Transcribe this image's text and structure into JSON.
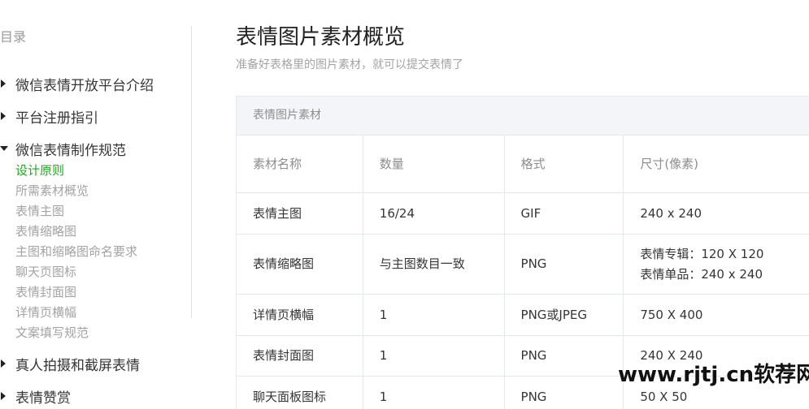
{
  "sidebar": {
    "title": "目录",
    "sections": [
      {
        "label": "微信表情开放平台介绍"
      },
      {
        "label": "平台注册指引"
      },
      {
        "label": "微信表情制作规范"
      },
      {
        "label": "真人拍摄和截屏表情"
      },
      {
        "label": "表情赞赏"
      }
    ],
    "sub_items": [
      {
        "label": "设计原则"
      },
      {
        "label": "所需素材概览"
      },
      {
        "label": "表情主图"
      },
      {
        "label": "表情缩略图"
      },
      {
        "label": "主图和缩略图命名要求"
      },
      {
        "label": "聊天页图标"
      },
      {
        "label": "表情封面图"
      },
      {
        "label": "详情页横幅"
      },
      {
        "label": "文案填写规范"
      }
    ]
  },
  "main": {
    "title": "表情图片素材概览",
    "subtitle": "准备好表格里的图片素材，就可以提交表情了",
    "table": {
      "caption": "表情图片素材",
      "headers": [
        "素材名称",
        "数量",
        "格式",
        "尺寸(像素)"
      ],
      "rows": [
        {
          "name": "表情主图",
          "count": "16/24",
          "format": "GIF",
          "size1": "240 x 240",
          "size2": ""
        },
        {
          "name": "表情缩略图",
          "count": "与主图数目一致",
          "format": "PNG",
          "size1": "表情专辑：120 X 120",
          "size2": "表情单品：240 x 240"
        },
        {
          "name": "详情页横幅",
          "count": "1",
          "format": "PNG或JPEG",
          "size1": "750 X 400",
          "size2": ""
        },
        {
          "name": "表情封面图",
          "count": "1",
          "format": "PNG",
          "size1": "240 X 240",
          "size2": ""
        },
        {
          "name": "聊天面板图标",
          "count": "1",
          "format": "PNG",
          "size1": "50 X 50",
          "size2": ""
        }
      ]
    }
  },
  "watermark": "www.rjtj.cn软荐网",
  "colors": {
    "active": "#1aad19",
    "muted": "#a3a3a3",
    "text": "#353535",
    "border": "#e4e8eb",
    "caption_bg": "#f4f5f9"
  }
}
